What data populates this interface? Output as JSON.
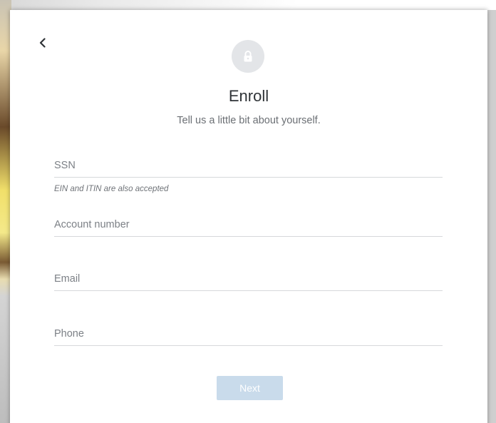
{
  "header": {
    "title": "Enroll",
    "subtitle": "Tell us a little bit about yourself.",
    "back_icon": "chevron-left-icon",
    "lock_icon": "lock-icon"
  },
  "form": {
    "ssn": {
      "placeholder": "SSN",
      "value": "",
      "hint": "EIN and ITIN are also accepted"
    },
    "account_number": {
      "placeholder": "Account number",
      "value": ""
    },
    "email": {
      "placeholder": "Email",
      "value": ""
    },
    "phone": {
      "placeholder": "Phone",
      "value": ""
    }
  },
  "actions": {
    "next_label": "Next"
  },
  "colors": {
    "button_disabled": "#c9dbeb",
    "lock_bg": "#e3e5e8",
    "divider": "#d6d8db"
  }
}
